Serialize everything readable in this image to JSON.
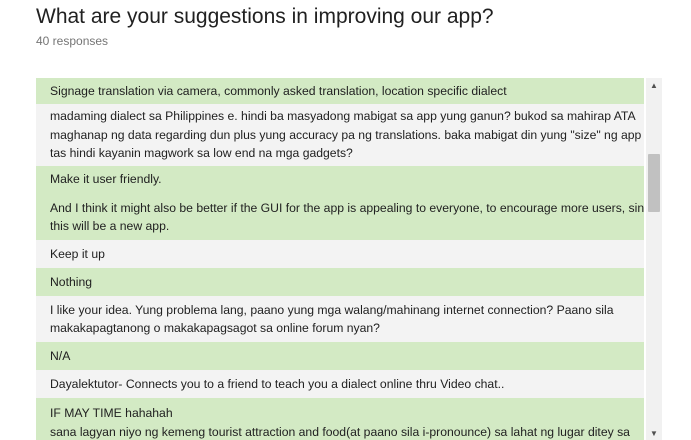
{
  "header": {
    "question": "What are your suggestions in improving our app?",
    "responses_count": "40 responses"
  },
  "responses": [
    {
      "lines": [
        "Signage translation via camera, commonly asked translation, location specific dialect"
      ]
    },
    {
      "lines": [
        "madaming dialect sa Philippines e. hindi ba masyadong mabigat sa app yung ganun? bukod sa mahirap ATA",
        "maghanap ng data regarding dun plus yung accuracy pa ng translations. baka mabigat din yung \"size\" ng app",
        "tas hindi kayanin magwork sa low end na mga gadgets?"
      ]
    },
    {
      "lines": [
        "Make it user friendly.",
        "",
        "And I think it might also be better if the GUI for the app is appealing to everyone, to encourage more users, since",
        "this will be a new app."
      ]
    },
    {
      "lines": [
        "Keep it up"
      ]
    },
    {
      "lines": [
        "Nothing"
      ]
    },
    {
      "lines": [
        "I like your idea. Yung problema lang, paano yung mga walang/mahinang internet connection? Paano sila",
        "makakapagtanong o makakapagsagot sa online forum nyan?"
      ]
    },
    {
      "lines": [
        "N/A"
      ]
    },
    {
      "lines": [
        "Dayalektutor- Connects you to a friend to teach you a dialect online thru Video chat.."
      ]
    },
    {
      "lines": [
        "IF MAY TIME hahahah",
        "sana lagyan niyo ng kemeng tourist attraction and food(at paano sila i-pronounce) sa lahat ng lugar ditey sa"
      ]
    }
  ],
  "scrollbar": {
    "up_icon": "▲",
    "down_icon": "▼"
  },
  "colors": {
    "row_green": "#d3eac4",
    "row_grey": "#f3f3f3",
    "text": "#212121",
    "muted": "#757575"
  }
}
